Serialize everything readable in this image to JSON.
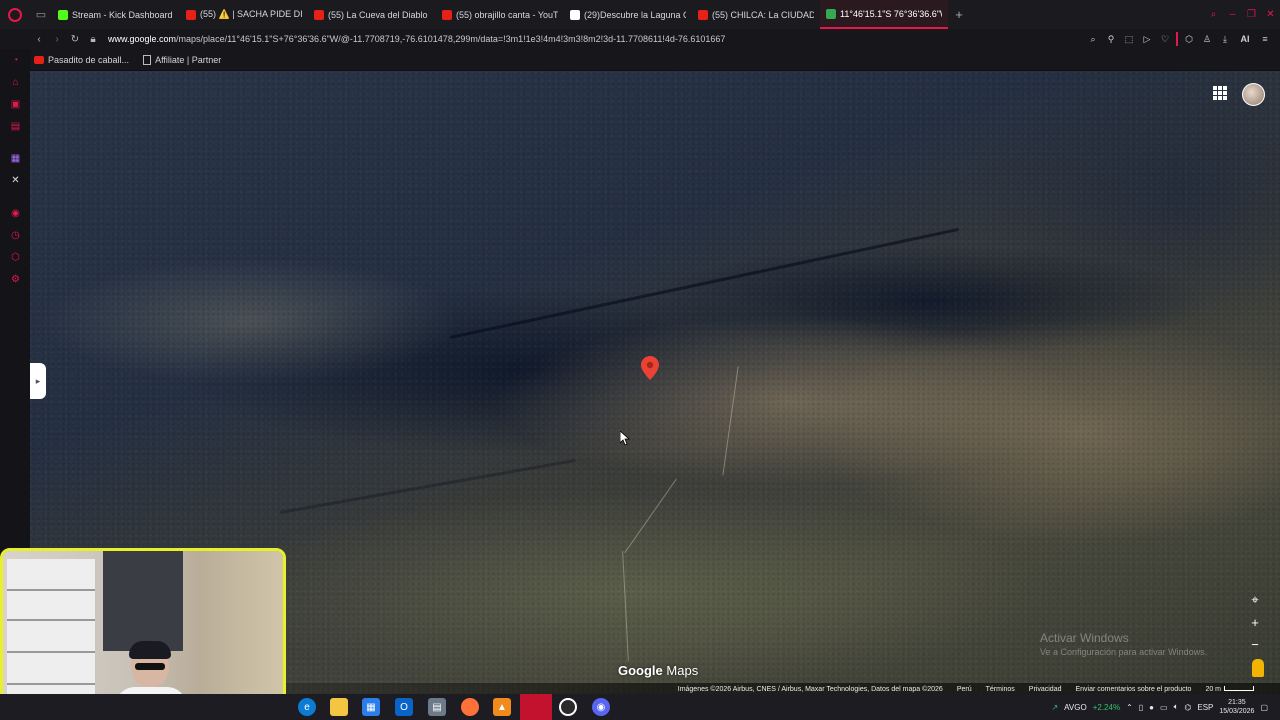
{
  "tabs": [
    {
      "title": "Stream - Kick Dashboard",
      "icon": "kick-icon",
      "color": "#53fc18"
    },
    {
      "title": "(55) ⚠️ | SACHA PIDE DIS",
      "icon": "youtube-icon",
      "color": "#e62117"
    },
    {
      "title": "(55) La Cueva del Diablo",
      "icon": "youtube-icon",
      "color": "#e62117"
    },
    {
      "title": "(55) obrajillo canta - YouT",
      "icon": "youtube-icon",
      "color": "#e62117"
    },
    {
      "title": "(29)Descubre la Laguna C",
      "icon": "tiktok-icon",
      "color": "#ffffff"
    },
    {
      "title": "(55) CHILCA: La CIUDAD",
      "icon": "youtube-icon",
      "color": "#e62117"
    },
    {
      "title": "11°46'15.1\"S 76°36'36.6\"W",
      "icon": "maps-icon",
      "color": "#34a853"
    }
  ],
  "address": {
    "host": "www.google.com",
    "path": "/maps/place/11°46'15.1\"S+76°36'36.6\"W/@-11.7708719,-76.6101478,299m/data=!3m1!1e3!4m4!3m3!8m2!3d-11.7708611!4d-76.6101667"
  },
  "toolbar": {
    "ai_label": "AI"
  },
  "bookmarks": [
    {
      "label": "Pasadito de caball...",
      "icon": "youtube-icon"
    },
    {
      "label": "Affiliate | Partner",
      "icon": "page-icon"
    }
  ],
  "map": {
    "logo_main": "Google",
    "logo_sub": "Maps",
    "attribution": "Imágenes ©2026 Airbus, CNES / Airbus, Maxar Technologies, Datos del mapa ©2026",
    "country": "Perú",
    "terms": "Términos",
    "privacy": "Privacidad",
    "feedback": "Enviar comentarios sobre el producto",
    "scale": "20 m",
    "zoom_in": "+",
    "zoom_out": "−"
  },
  "watermark": {
    "line1": "Activar Windows",
    "line2": "Ve a Configuración para activar Windows."
  },
  "tray": {
    "stock_symbol": "AVGO",
    "stock_change": "+2.24%",
    "language": "ESP",
    "time": "21:35",
    "date": "15/03/2026"
  },
  "colors": {
    "accent": "#e5174b",
    "webcam_border": "#e8f02a",
    "pin": "#ea4335"
  }
}
